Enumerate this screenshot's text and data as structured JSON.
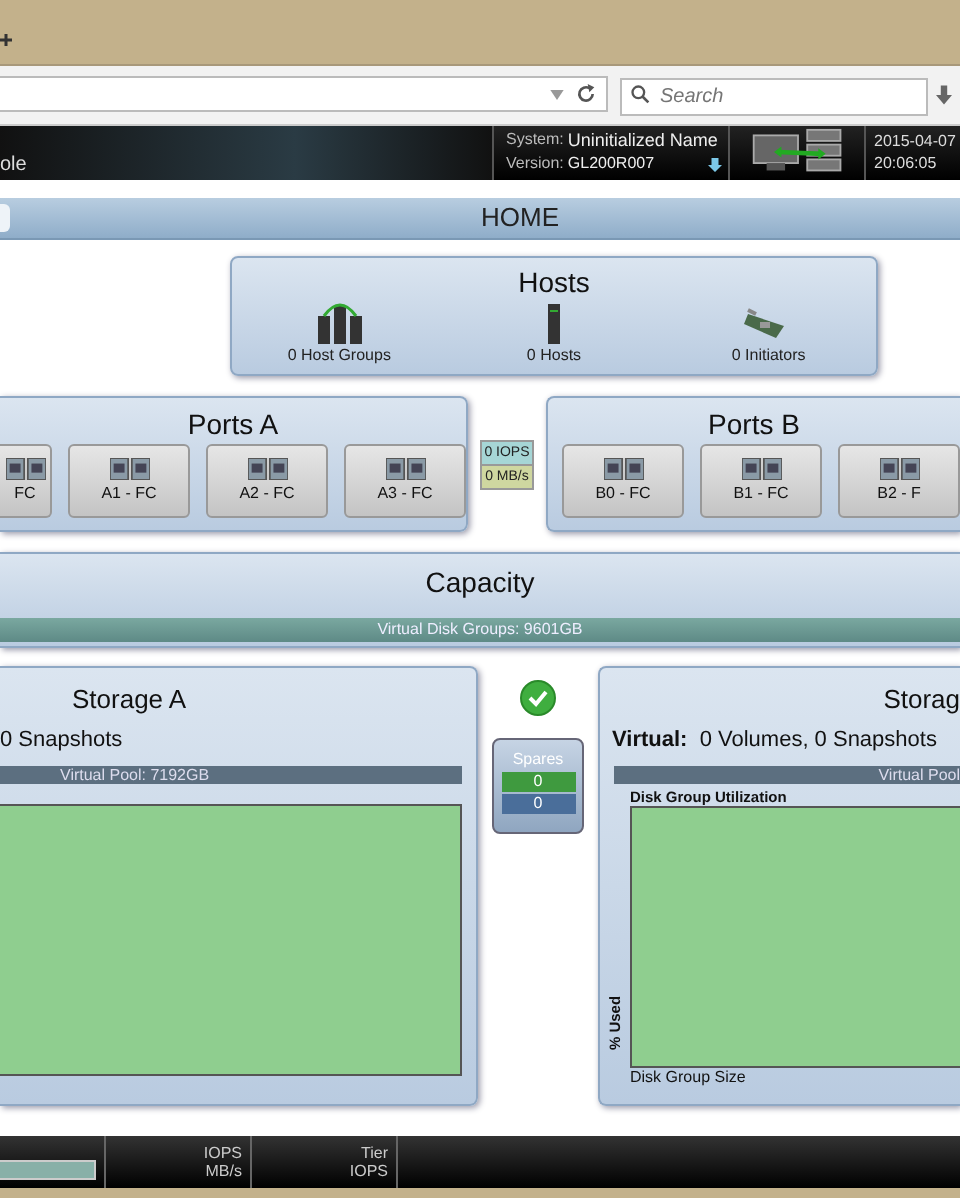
{
  "browser": {
    "search": {
      "placeholder": "Search"
    }
  },
  "header": {
    "app_title": "ole",
    "system_label": "System:",
    "system_name": "Uninitialized Name",
    "version_label": "Version:",
    "version": "GL200R007",
    "date": "2015-04-07",
    "time": "20:06:05"
  },
  "page_title": "HOME",
  "hosts": {
    "title": "Hosts",
    "items": [
      {
        "kind": "host-group",
        "label": "0 Host Groups"
      },
      {
        "kind": "host",
        "label": "0 Hosts"
      },
      {
        "kind": "initiator",
        "label": "0 Initiators"
      }
    ]
  },
  "ports_a": {
    "title": "Ports A",
    "ports": [
      {
        "label": "FC"
      },
      {
        "label": "A1 - FC"
      },
      {
        "label": "A2 - FC"
      },
      {
        "label": "A3 - FC"
      }
    ]
  },
  "throughput": {
    "iops": "0 IOPS",
    "mbps": "0 MB/s"
  },
  "ports_b": {
    "title": "Ports B",
    "ports": [
      {
        "label": "B0 - FC"
      },
      {
        "label": "B1 - FC"
      },
      {
        "label": "B2 - F"
      }
    ]
  },
  "capacity": {
    "title": "Capacity",
    "bar_label": "Virtual Disk Groups: 9601GB"
  },
  "storage_a": {
    "title": "Storage A",
    "summary": "0 Snapshots",
    "pool_label": "Virtual Pool: 7192GB"
  },
  "spares": {
    "title": "Spares",
    "counts": [
      "0",
      "0"
    ]
  },
  "storage_b": {
    "title": "Storag",
    "summary_label": "Virtual:",
    "summary": "0 Volumes, 0 Snapshots",
    "pool_label": "Virtual Pool",
    "chart_title": "Disk Group Utilization",
    "y_label": "% Used",
    "x_label": "Disk Group Size"
  },
  "footer": {
    "cells": [
      {
        "top": "IOPS",
        "bottom": "MB/s"
      },
      {
        "top": "Tier",
        "bottom": "IOPS"
      }
    ]
  }
}
